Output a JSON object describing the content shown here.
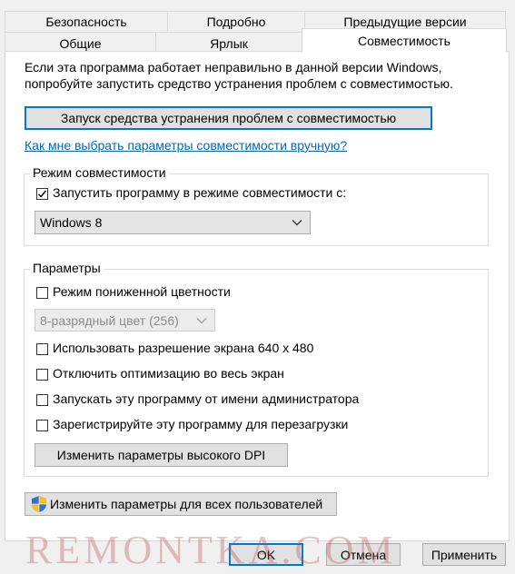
{
  "tabs": {
    "row1": [
      "Безопасность",
      "Подробно",
      "Предыдущие версии"
    ],
    "row2": [
      "Общие",
      "Ярлык",
      "Совместимость"
    ]
  },
  "intro": {
    "line1": "Если эта программа работает неправильно в данной версии Windows,",
    "line2": "попробуйте запустить средство устранения проблем с совместимостью."
  },
  "troubleshooter_button": "Запуск средства устранения проблем с совместимостью",
  "manual_link": "Как мне выбрать параметры совместимости вручную?",
  "compat_mode": {
    "legend": "Режим совместимости",
    "checkbox_label": "Запустить программу в режиме совместимости с:",
    "checked": true,
    "selected": "Windows 8"
  },
  "params": {
    "legend": "Параметры",
    "reduced_color_label": "Режим пониженной цветности",
    "color_select": "8-разрядный цвет (256)",
    "res_640_label": "Использовать разрешение экрана 640 x 480",
    "fullscreen_opt_label": "Отключить оптимизацию во весь экран",
    "run_admin_label": "Запускать эту программу от имени администратора",
    "register_restart_label": "Зарегистрируйте эту программу для перезагрузки",
    "dpi_button": "Изменить параметры высокого DPI"
  },
  "all_users_button": "Изменить параметры для всех пользователей",
  "footer": {
    "ok": "OK",
    "cancel": "Отмена",
    "apply": "Применить"
  },
  "watermark": "REMONTKA.COM",
  "colors": {
    "accent": "#0078d7",
    "link": "#0066cc"
  }
}
